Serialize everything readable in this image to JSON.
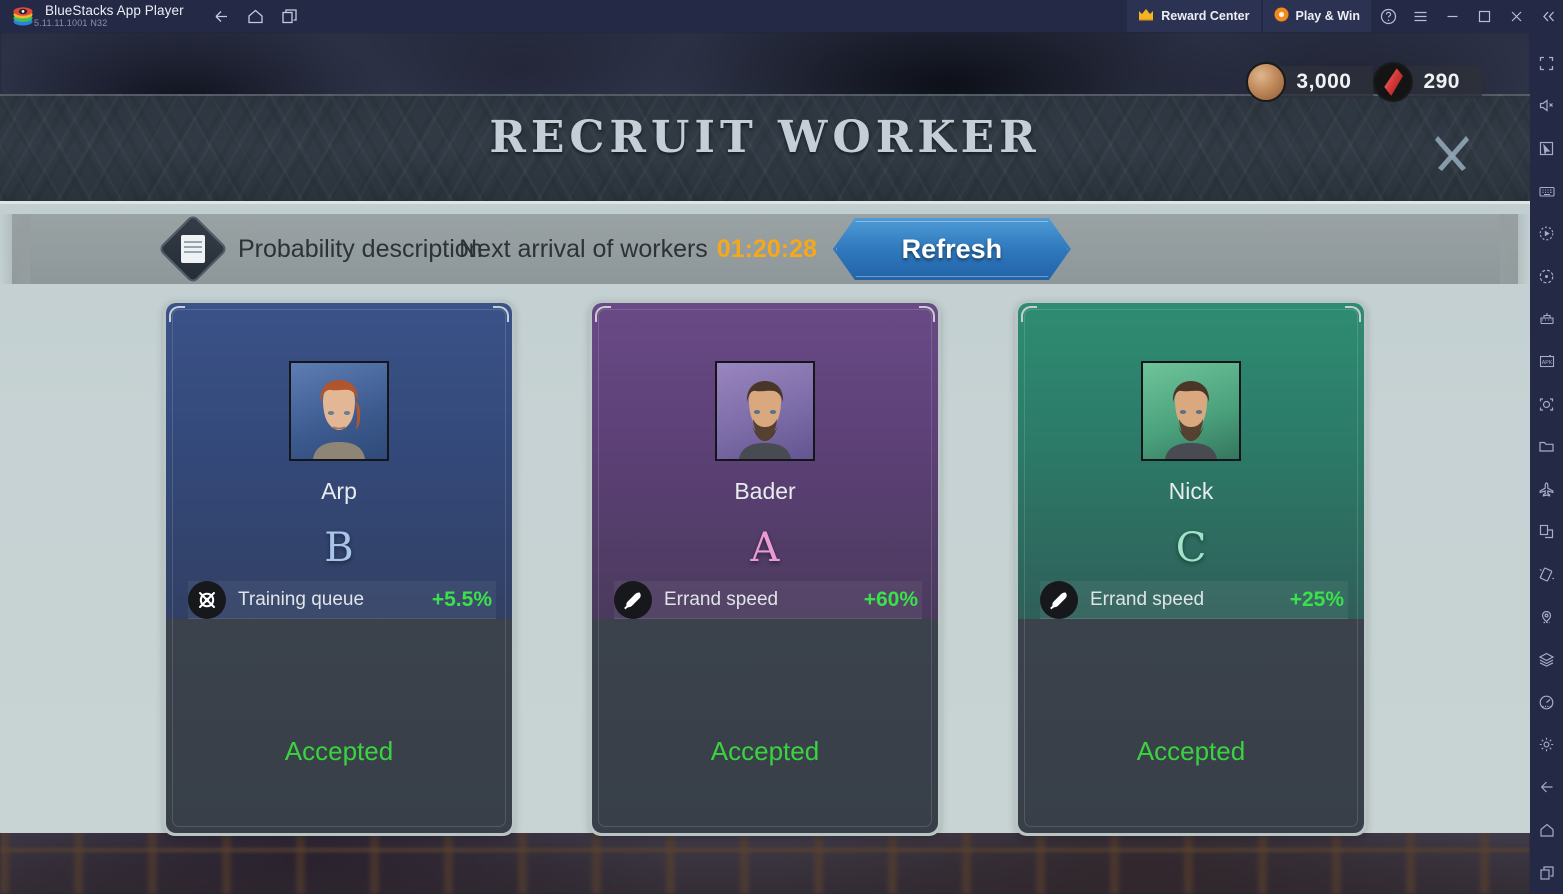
{
  "titlebar": {
    "logo_icon": "bluestacks-logo-icon",
    "app_name": "BlueStacks App Player",
    "version": "5.11.11.1001  N32",
    "nav": [
      {
        "name": "back",
        "icon": "arrow-left-icon"
      },
      {
        "name": "home",
        "icon": "home-icon"
      },
      {
        "name": "recents",
        "icon": "recent-apps-icon"
      }
    ],
    "reward_center": {
      "label": "Reward Center",
      "icon": "crown-icon"
    },
    "play_win": {
      "label": "Play & Win",
      "icon": "coin-badge-icon"
    },
    "window_icons": [
      {
        "name": "help",
        "icon": "help-circle-icon"
      },
      {
        "name": "menu",
        "icon": "hamburger-menu-icon"
      },
      {
        "name": "minimize",
        "icon": "minimize-icon"
      },
      {
        "name": "maximize",
        "icon": "maximize-icon"
      },
      {
        "name": "close",
        "icon": "close-icon"
      },
      {
        "name": "collapse-sidebar",
        "icon": "chevron-double-left-icon"
      }
    ]
  },
  "currency": {
    "coin": {
      "icon": "bronze-coin-icon",
      "value": "3,000"
    },
    "gem": {
      "icon": "red-crystal-icon",
      "value": "290"
    }
  },
  "header": {
    "title": "RECRUIT WORKER",
    "close_icon": "close-x-brush-icon"
  },
  "strip": {
    "probability": {
      "icon": "scroll-document-icon",
      "label": "Probability description"
    },
    "timer_label": "Next arrival of workers",
    "timer_value": "01:20:28",
    "refresh_label": "Refresh"
  },
  "colors": {
    "accent_blue": "#2f79bd",
    "timer_orange": "#f4a81d",
    "positive_green": "#3ae14a",
    "accepted_green": "#3ad33f",
    "grade_b": "#a9c4ea",
    "grade_a": "#eb9ad8",
    "grade_c": "#9fe3c8"
  },
  "cards": [
    {
      "name": "Arp",
      "grade": "B",
      "grade_color": "#a9c4ea",
      "card_top_gradient": "linear-gradient(180deg,#3a5288 0%, #34497a 45%, #313f63 100%)",
      "portrait_bg": "linear-gradient(160deg,#5d7db4 0%, #3c5a8e 60%, #2f4a79 100%)",
      "hair": "#b0552c",
      "skin": "#e3b695",
      "skill": {
        "icon": "crossed-swords-target-icon",
        "label": "Training queue",
        "value": "+5.5%"
      },
      "status": "Accepted"
    },
    {
      "name": "Bader",
      "grade": "A",
      "grade_color": "#eb9ad8",
      "card_top_gradient": "linear-gradient(180deg,#6a4a86 0%, #5c4076 45%, #4a3a5c 100%)",
      "portrait_bg": "linear-gradient(160deg,#9a86c0 0%, #7a6aa6 60%, #635591 100%)",
      "hair": "#4a3628",
      "skin": "#d9a87f",
      "skill": {
        "icon": "boot-speed-icon",
        "label": "Errand speed",
        "value": "+60%"
      },
      "status": "Accepted"
    },
    {
      "name": "Nick",
      "grade": "C",
      "grade_color": "#9fe3c8",
      "card_top_gradient": "linear-gradient(180deg,#2e8c72 0%, #2c7a68 45%, #2f5e58 100%)",
      "portrait_bg": "linear-gradient(160deg,#6fc49a 0%, #49a07b 60%, #35755f 100%)",
      "hair": "#4a3628",
      "skin": "#d9a87f",
      "skill": {
        "icon": "boot-speed-icon",
        "label": "Errand speed",
        "value": "+25%"
      },
      "status": "Accepted"
    }
  ],
  "sidebar": {
    "items": [
      {
        "name": "fullscreen",
        "icon": "fullscreen-icon"
      },
      {
        "name": "mute",
        "icon": "speaker-mute-icon"
      },
      {
        "name": "pointer-mode",
        "icon": "cursor-pointer-icon"
      },
      {
        "name": "keyboard-controls",
        "icon": "keyboard-icon"
      },
      {
        "name": "macro-recorder",
        "icon": "play-record-icon"
      },
      {
        "name": "rotate",
        "icon": "rotate-icon"
      },
      {
        "name": "multi-instance",
        "icon": "multi-instance-icon"
      },
      {
        "name": "install-apk",
        "icon": "apk-install-icon"
      },
      {
        "name": "screenshot",
        "icon": "camera-icon"
      },
      {
        "name": "media-manager",
        "icon": "folder-icon"
      },
      {
        "name": "eco-mode",
        "icon": "airplane-icon"
      },
      {
        "name": "resize-window",
        "icon": "resize-window-icon"
      },
      {
        "name": "shake",
        "icon": "shake-icon"
      },
      {
        "name": "location",
        "icon": "location-pin-icon"
      },
      {
        "name": "layers",
        "icon": "layers-icon"
      },
      {
        "name": "performance",
        "icon": "gauge-icon"
      }
    ],
    "bottom_items": [
      {
        "name": "settings",
        "icon": "gear-icon"
      },
      {
        "name": "android-back",
        "icon": "arrow-left-icon"
      },
      {
        "name": "android-home",
        "icon": "home-icon"
      },
      {
        "name": "android-recents",
        "icon": "recent-apps-icon"
      }
    ]
  }
}
